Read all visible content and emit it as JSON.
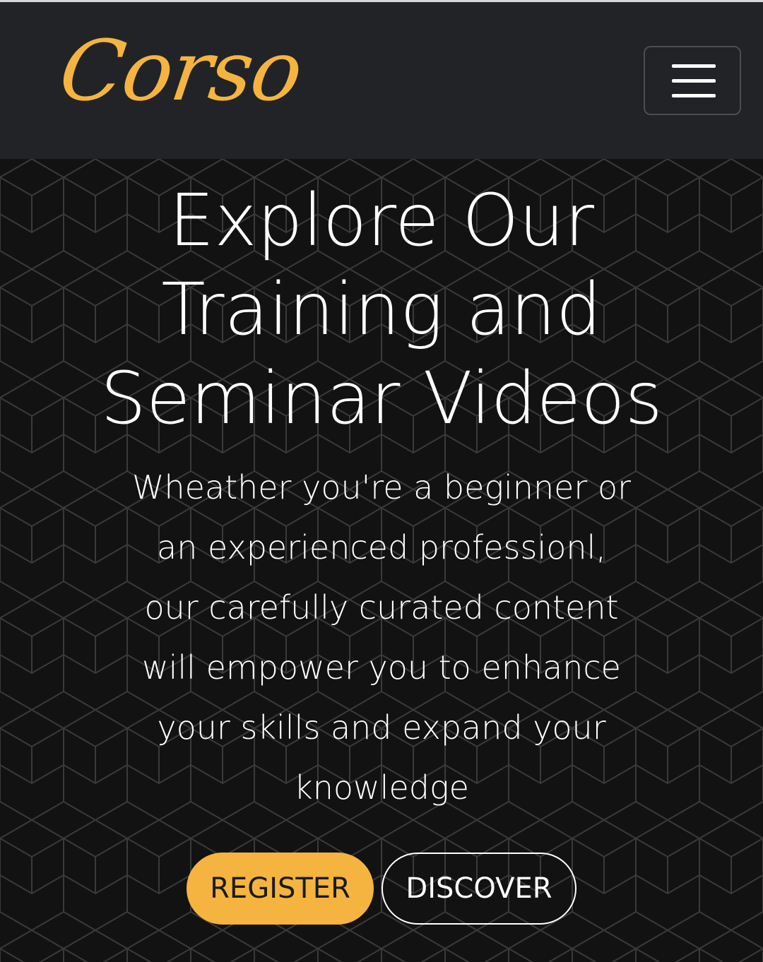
{
  "navbar": {
    "brand": "Corso",
    "menu_icon": "hamburger-menu-icon"
  },
  "hero": {
    "title_lines": [
      "Explore Our",
      "Training and",
      "Seminar Videos"
    ],
    "text_lines": [
      "Wheather you're a beginner or",
      "an experienced professionl,",
      "our carefully curated content",
      "will empower you to enhance",
      "your skills and expand your",
      "knowledge"
    ],
    "register_label": "REGISTER",
    "discover_label": "DISCOVER"
  },
  "colors": {
    "accent": "#f4b43f",
    "navbar_bg": "#212326",
    "hero_bg": "#111111",
    "text": "#ffffff"
  }
}
